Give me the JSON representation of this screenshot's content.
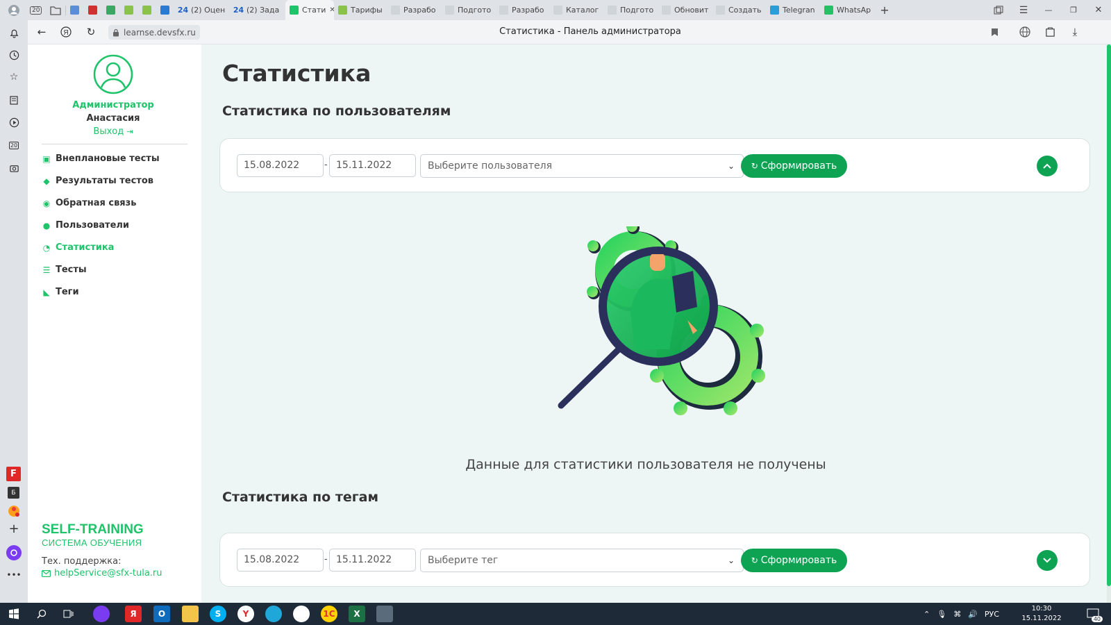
{
  "browser": {
    "tabs": [
      {
        "label": "",
        "fav": "#5b8dd9"
      },
      {
        "label": "",
        "fav": "#d03030"
      },
      {
        "label": "",
        "fav": "#3aa864"
      },
      {
        "label": "",
        "fav": "#8bc34a"
      },
      {
        "label": "",
        "fav": "#8bc34a"
      },
      {
        "label": "",
        "fav": "#2b7ad1"
      },
      {
        "label": "(2) Оцен",
        "fav": "#1f5fbf"
      },
      {
        "label": "(2) Зада",
        "fav": "#1f5fbf"
      },
      {
        "label": "Стати",
        "fav": "#1ec36a",
        "active": true
      },
      {
        "label": "Тарифы",
        "fav": "#8bc34a"
      },
      {
        "label": "Разрабо",
        "fav": "#cfd4d9"
      },
      {
        "label": "Подгото",
        "fav": "#cfd4d9"
      },
      {
        "label": "Разрабо",
        "fav": "#cfd4d9"
      },
      {
        "label": "Каталог",
        "fav": "#cfd4d9"
      },
      {
        "label": "Подгото",
        "fav": "#cfd4d9"
      },
      {
        "label": "Обновит",
        "fav": "#cfd4d9"
      },
      {
        "label": "Создать",
        "fav": "#cfd4d9"
      },
      {
        "label": "Telegran",
        "fav": "#2a9ed8"
      },
      {
        "label": "WhatsAp",
        "fav": "#25c165"
      }
    ],
    "tab_counter": "20",
    "url": "learnse.devsfx.ru",
    "page_title": "Статистика - Панель администратора",
    "tab24": "24"
  },
  "sidebar": {
    "role": "Администратор",
    "name": "Анастасия",
    "logout": "Выход",
    "menu": [
      {
        "label": "Внеплановые тесты",
        "icon": "calendar-check-icon",
        "active": false
      },
      {
        "label": "Результаты тестов",
        "icon": "graduation-cap-icon",
        "active": false
      },
      {
        "label": "Обратная связь",
        "icon": "comments-icon",
        "active": false
      },
      {
        "label": "Пользователи",
        "icon": "users-icon",
        "active": false
      },
      {
        "label": "Статистика",
        "icon": "pie-chart-icon",
        "active": true
      },
      {
        "label": "Тесты",
        "icon": "list-icon",
        "active": false
      },
      {
        "label": "Теги",
        "icon": "tag-icon",
        "active": false
      }
    ],
    "brand_title": "SELF-TRAINING",
    "brand_subtitle": "СИСТЕМА ОБУЧЕНИЯ",
    "support_label": "Тех. поддержка:",
    "support_email": "helpService@sfx-tula.ru"
  },
  "main": {
    "title": "Статистика",
    "users_section": {
      "heading": "Статистика по пользователям",
      "date_from": "15.08.2022",
      "date_to": "15.11.2022",
      "select_placeholder": "Выберите пользователя",
      "button": "Сформировать",
      "empty_message": "Данные для статистики пользователя не получены"
    },
    "tags_section": {
      "heading": "Статистика по тегам",
      "date_from": "15.08.2022",
      "date_to": "15.11.2022",
      "select_placeholder": "Выберите тег",
      "button": "Сформировать"
    }
  },
  "taskbar": {
    "lang": "РУС",
    "time": "10:30",
    "date": "15.11.2022",
    "notifications": "40"
  },
  "colors": {
    "accent": "#1ec36a",
    "button": "#0ea352",
    "main_bg": "#eef6f5"
  }
}
